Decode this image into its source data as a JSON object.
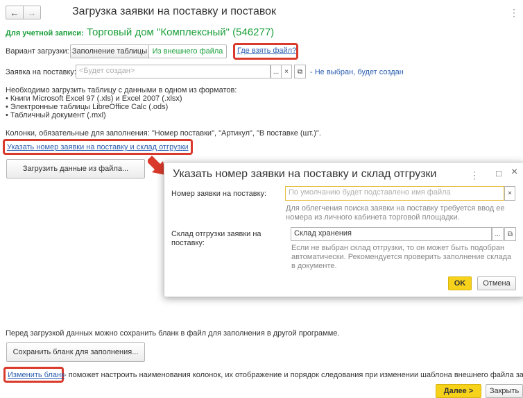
{
  "window": {
    "title": "Загрузка заявки на поставку и поставок",
    "menu_icon": "more-vertical-icon"
  },
  "nav": {
    "back_icon": "←",
    "forward_icon": "→"
  },
  "account": {
    "label": "Для учетной записи:",
    "value": "Торговый дом \"Комплексный\" (546277)"
  },
  "load_variant": {
    "label": "Вариант загрузки:",
    "options": [
      "Заполнение таблицы",
      "Из внешнего файла"
    ],
    "selected": "Из внешнего файла",
    "help_link": "Где взять файл?"
  },
  "order_field": {
    "label": "Заявка на поставку:",
    "placeholder": "<Будет создан>",
    "btn_select": "...",
    "btn_clear": "×",
    "btn_open": "⧉",
    "status": "- Не выбран, будет создан"
  },
  "info": {
    "line1": "Необходимо загрузить таблицу с данными в одном из форматов:",
    "line2": "• Книги Microsoft Excel 97 (.xls) и Excel 2007 (.xlsx)",
    "line3": "• Электронные таблицы LibreOffice Calc (.ods)",
    "line4": "• Табличный документ (.mxl)",
    "columns": "Колонки, обязательные для заполнения: \"Номер поставки\", \"Артикул\", \"В поставке (шт.)\"."
  },
  "specify_link": "Указать номер заявки на поставку и склад отгрузки",
  "load_button": "Загрузить данные из файла...",
  "dialog": {
    "title": "Указать номер заявки на поставку и склад отгрузки",
    "menu_icon": "more-vertical-icon",
    "maximize_icon": "□",
    "close_icon": "×",
    "order_label": "Номер заявки на поставку:",
    "order_placeholder": "По умолчанию будет подставлено имя файла",
    "order_clear": "×",
    "order_hint": "Для облегчения поиска заявки на поставку требуется ввод ее номера из личного кабинета торговой площадки.",
    "warehouse_label": "Склад отгрузки заявки на поставку:",
    "warehouse_value": "Склад хранения",
    "warehouse_select": "...",
    "warehouse_open": "⧉",
    "warehouse_hint": "Если не выбран склад отгрузки, то он может быть подобран автоматически. Рекомендуется проверить заполнение склада в документе.",
    "ok": "OK",
    "cancel": "Отмена"
  },
  "template": {
    "note": "Перед загрузкой данных можно сохранить бланк в файл для заполнения в другой программе.",
    "save_button": "Сохранить бланк для заполнения...",
    "change_link": "Изменить бланк",
    "change_note": "- поможет настроить наименования колонок, их отображение и порядок следования при изменении шаблона внешнего файла загрузки."
  },
  "footer": {
    "next": "Далее >",
    "close": "Закрыть"
  },
  "colors": {
    "accent_green": "#1a9f3a",
    "link_blue": "#2a5db0",
    "ok_yellow": "#f6d21b",
    "annotation_red": "#d93a2b"
  }
}
